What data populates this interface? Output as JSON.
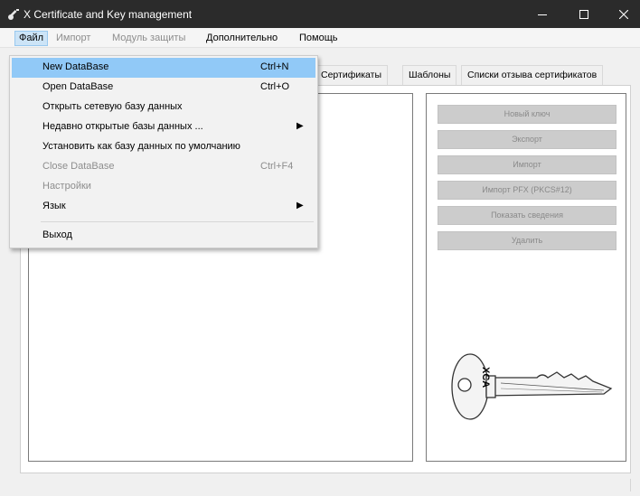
{
  "window": {
    "title": "X Certificate and Key management",
    "icons": {
      "app": "key-app-icon",
      "minimize": "minimize-icon",
      "maximize": "maximize-icon",
      "close": "close-icon"
    },
    "colors": {
      "titlebar": "#2b2b2b",
      "menu_highlight": "#91c9f7"
    }
  },
  "menubar": {
    "items": [
      "Файл",
      "Импорт",
      "Модуль защиты",
      "Дополнительно",
      "Помощь"
    ]
  },
  "tabs": [
    "Сертификаты",
    "Шаблоны",
    "Списки отзыва сертификатов"
  ],
  "buttons": [
    "Новый ключ",
    "Экспорт",
    "Импорт",
    "Импорт PFX (PKCS#12)",
    "Показать сведения",
    "Удалить"
  ],
  "key_label": "XCA",
  "file_menu": {
    "items": [
      {
        "label": "New DataBase",
        "shortcut": "Ctrl+N",
        "state": "highlighted"
      },
      {
        "label": "Open DataBase",
        "shortcut": "Ctrl+O",
        "state": "normal"
      },
      {
        "label": "Открыть сетевую базу данных",
        "shortcut": "",
        "state": "normal"
      },
      {
        "label": "Недавно открытые базы данных ...",
        "shortcut": "",
        "state": "submenu"
      },
      {
        "label": "Установить как базу данных по умолчанию",
        "shortcut": "",
        "state": "normal"
      },
      {
        "label": "Close DataBase",
        "shortcut": "Ctrl+F4",
        "state": "disabled"
      },
      {
        "label": "Настройки",
        "shortcut": "",
        "state": "disabled"
      },
      {
        "label": "Язык",
        "shortcut": "",
        "state": "submenu"
      },
      {
        "label": "Выход",
        "shortcut": "",
        "state": "normal"
      }
    ]
  }
}
